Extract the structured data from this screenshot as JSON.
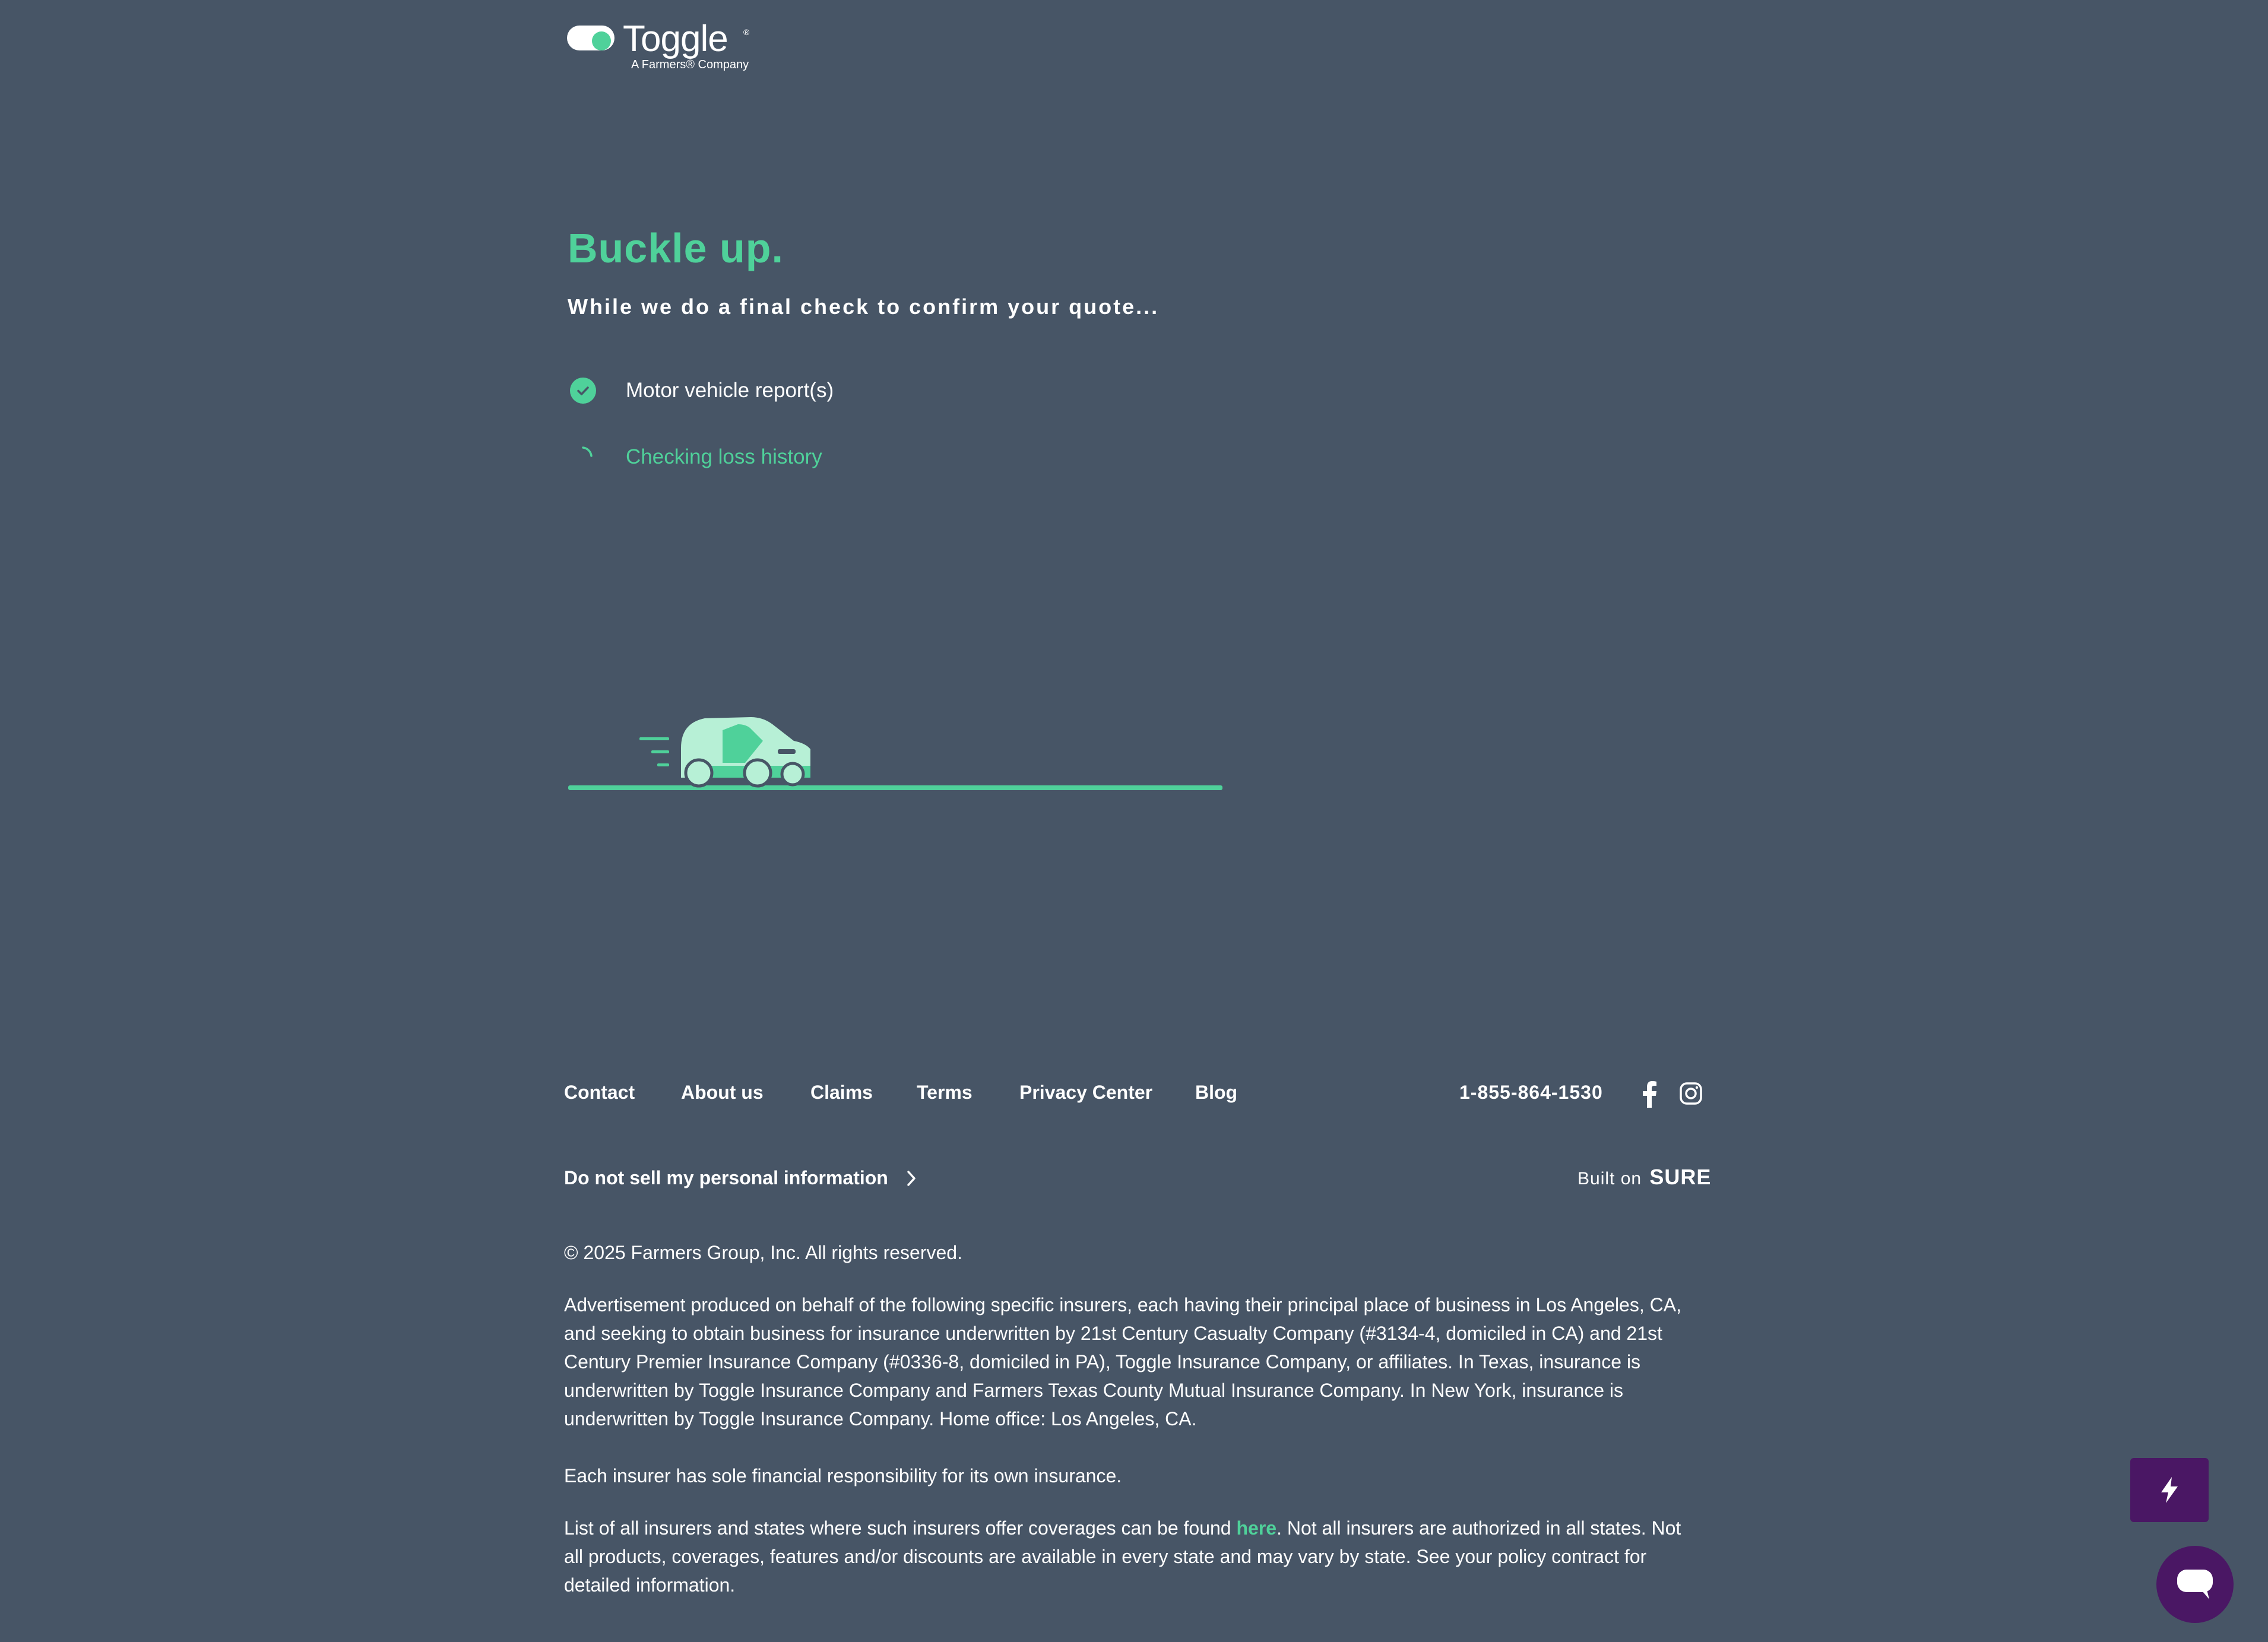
{
  "logo": {
    "brand": "Toggle",
    "registered": "®",
    "tagline": "A Farmers® Company"
  },
  "main": {
    "headline": "Buckle up.",
    "subhead": "While we do a final check to confirm your quote...",
    "steps": [
      {
        "label": "Motor vehicle report(s)",
        "status": "complete"
      },
      {
        "label": "Checking loss history",
        "status": "in-progress"
      }
    ]
  },
  "footer": {
    "links": [
      "Contact",
      "About us",
      "Claims",
      "Terms",
      "Privacy Center",
      "Blog"
    ],
    "phone": "1-855-864-1530",
    "do_not_sell": "Do not sell my personal information",
    "built_on_prefix": "Built on",
    "built_on_brand": "SURE",
    "copyright": "© 2025 Farmers Group, Inc. All rights reserved.",
    "legal_p1": "Advertisement produced on behalf of the following specific insurers, each having their principal place of business in Los Angeles, CA, and seeking to obtain business for insurance underwritten by 21st Century Casualty Company (#3134-4, domiciled in CA) and 21st Century Premier Insurance Company (#0336-8, domiciled in PA), Toggle Insurance Company, or affiliates. In Texas, insurance is underwritten by Toggle Insurance Company and Farmers Texas County Mutual Insurance Company. In New York, insurance is underwritten by Toggle Insurance Company. Home office: Los Angeles, CA.",
    "legal_p2": "Each insurer has sole financial responsibility for its own insurance.",
    "legal_p3_before": "List of all insurers and states where such insurers offer coverages can be found ",
    "legal_p3_link": "here",
    "legal_p3_after": ". Not all insurers are authorized in all states. Not all products, coverages, features and/or discounts are available in every state and may vary by state. See your policy contract for detailed information."
  },
  "colors": {
    "background": "#475566",
    "accent": "#4fd19a",
    "widget": "#4a1764"
  }
}
